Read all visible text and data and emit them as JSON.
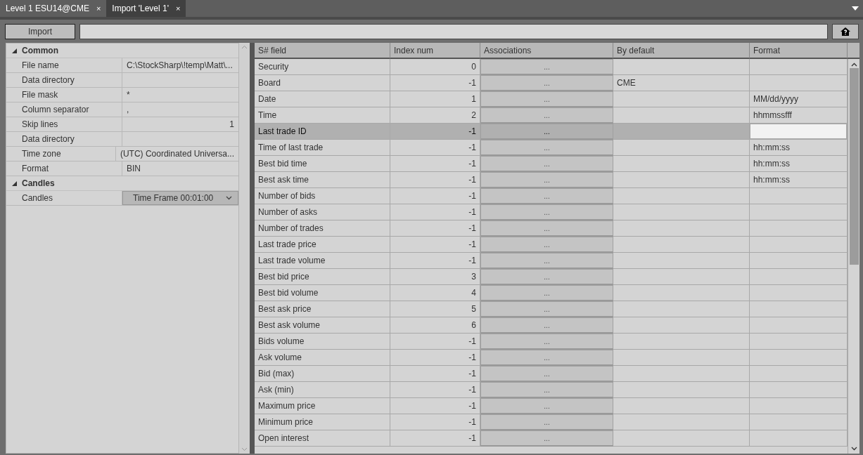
{
  "tabs": [
    {
      "label": "Level 1 ESU14@CME",
      "close": "×",
      "selected": false
    },
    {
      "label": "Import 'Level 1'",
      "close": "×",
      "selected": true
    }
  ],
  "toolbar": {
    "import_button": "Import"
  },
  "properties": [
    {
      "category": "Common",
      "expanded": true,
      "items": [
        {
          "name": "File name",
          "value": "C:\\StockSharp\\!temp\\Matt\\...",
          "kind": "text"
        },
        {
          "name": "Data directory",
          "value": "",
          "kind": "text"
        },
        {
          "name": "File mask",
          "value": "*",
          "kind": "text"
        },
        {
          "name": "Column separator",
          "value": ",",
          "kind": "text"
        },
        {
          "name": "Skip lines",
          "value": "1",
          "kind": "number"
        },
        {
          "name": "Data directory",
          "value": "",
          "kind": "text"
        },
        {
          "name": "Time zone",
          "value": "(UTC) Coordinated Universa...",
          "kind": "text"
        },
        {
          "name": "Format",
          "value": "BIN",
          "kind": "text"
        }
      ]
    },
    {
      "category": "Candles",
      "expanded": true,
      "items": [
        {
          "name": "Candles",
          "value": "Time Frame 00:01:00",
          "kind": "dropdown"
        }
      ]
    }
  ],
  "table": {
    "columns": [
      "S# field",
      "Index num",
      "Associations",
      "By default",
      "Format"
    ],
    "rows": [
      {
        "field": "Security",
        "index": "0",
        "associations": "...",
        "by_default": "",
        "format": "",
        "selected": false
      },
      {
        "field": "Board",
        "index": "-1",
        "associations": "...",
        "by_default": "CME",
        "format": "",
        "selected": false
      },
      {
        "field": "Date",
        "index": "1",
        "associations": "...",
        "by_default": "",
        "format": "MM/dd/yyyy",
        "selected": false
      },
      {
        "field": "Time",
        "index": "2",
        "associations": "...",
        "by_default": "",
        "format": "hhmmssfff",
        "selected": false
      },
      {
        "field": "Last trade ID",
        "index": "-1",
        "associations": "...",
        "by_default": "",
        "format": "",
        "selected": true
      },
      {
        "field": "Time of last trade",
        "index": "-1",
        "associations": "...",
        "by_default": "",
        "format": "hh:mm:ss",
        "selected": false
      },
      {
        "field": "Best bid time",
        "index": "-1",
        "associations": "...",
        "by_default": "",
        "format": "hh:mm:ss",
        "selected": false
      },
      {
        "field": "Best ask time",
        "index": "-1",
        "associations": "...",
        "by_default": "",
        "format": "hh:mm:ss",
        "selected": false
      },
      {
        "field": "Number of bids",
        "index": "-1",
        "associations": "...",
        "by_default": "",
        "format": "",
        "selected": false
      },
      {
        "field": "Number of asks",
        "index": "-1",
        "associations": "...",
        "by_default": "",
        "format": "",
        "selected": false
      },
      {
        "field": "Number of trades",
        "index": "-1",
        "associations": "...",
        "by_default": "",
        "format": "",
        "selected": false
      },
      {
        "field": "Last trade price",
        "index": "-1",
        "associations": "...",
        "by_default": "",
        "format": "",
        "selected": false
      },
      {
        "field": "Last trade volume",
        "index": "-1",
        "associations": "...",
        "by_default": "",
        "format": "",
        "selected": false
      },
      {
        "field": "Best bid price",
        "index": "3",
        "associations": "...",
        "by_default": "",
        "format": "",
        "selected": false
      },
      {
        "field": "Best bid volume",
        "index": "4",
        "associations": "...",
        "by_default": "",
        "format": "",
        "selected": false
      },
      {
        "field": "Best ask price",
        "index": "5",
        "associations": "...",
        "by_default": "",
        "format": "",
        "selected": false
      },
      {
        "field": "Best ask volume",
        "index": "6",
        "associations": "...",
        "by_default": "",
        "format": "",
        "selected": false
      },
      {
        "field": "Bids volume",
        "index": "-1",
        "associations": "...",
        "by_default": "",
        "format": "",
        "selected": false
      },
      {
        "field": "Ask volume",
        "index": "-1",
        "associations": "...",
        "by_default": "",
        "format": "",
        "selected": false
      },
      {
        "field": "Bid (max)",
        "index": "-1",
        "associations": "...",
        "by_default": "",
        "format": "",
        "selected": false
      },
      {
        "field": "Ask (min)",
        "index": "-1",
        "associations": "...",
        "by_default": "",
        "format": "",
        "selected": false
      },
      {
        "field": "Maximum price",
        "index": "-1",
        "associations": "...",
        "by_default": "",
        "format": "",
        "selected": false
      },
      {
        "field": "Minimum price",
        "index": "-1",
        "associations": "...",
        "by_default": "",
        "format": "",
        "selected": false
      },
      {
        "field": "Open interest",
        "index": "-1",
        "associations": "...",
        "by_default": "",
        "format": "",
        "selected": false
      }
    ]
  }
}
